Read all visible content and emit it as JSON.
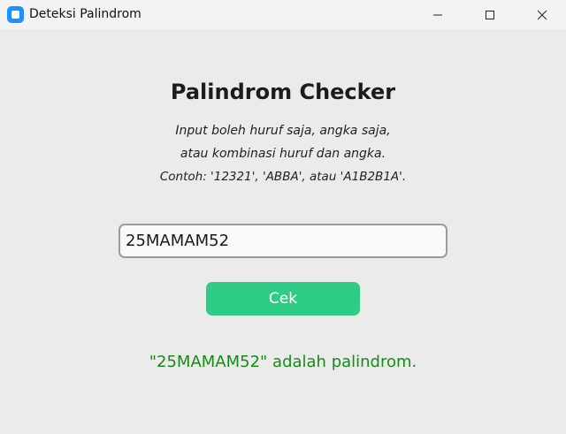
{
  "window": {
    "title": "Deteksi Palindrom",
    "app_icon": "app-icon"
  },
  "window_controls": {
    "minimize": "minimize-icon",
    "maximize": "maximize-icon",
    "close": "close-icon"
  },
  "main": {
    "heading": "Palindrom Checker",
    "description_lines": [
      "Input boleh huruf saja, angka saja,",
      "atau kombinasi huruf dan angka.",
      "Contoh: '12321', 'ABBA', atau 'A1B2B1A'."
    ],
    "input_value": "25MAMAM52",
    "check_button_label": "Cek",
    "result_text": "\"25MAMAM52\" adalah palindrom."
  },
  "colors": {
    "background": "#ebebeb",
    "button": "#2ecc84",
    "result_text": "#188a18",
    "app_icon": "#1e90ff"
  }
}
